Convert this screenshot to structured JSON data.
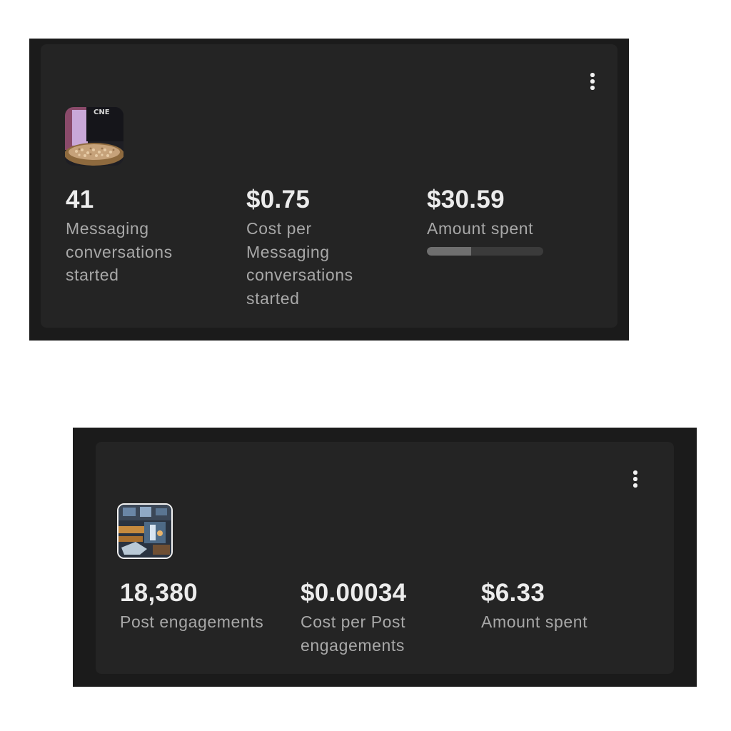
{
  "cards": [
    {
      "thumb_icon": "food-bowl-thumbnail",
      "thumb_text": "CNE",
      "metrics": [
        {
          "value": "41",
          "label_lines": [
            "Messaging",
            "conversations",
            "started"
          ]
        },
        {
          "value": "$0.75",
          "label_lines": [
            "Cost per",
            "Messaging",
            "conversations",
            "started"
          ]
        },
        {
          "value": "$30.59",
          "label_lines": [
            "Amount spent"
          ]
        }
      ],
      "spend_progress": 0.38,
      "menu_icon": "more-vertical-icon"
    },
    {
      "thumb_icon": "restaurant-thumbnail",
      "metrics": [
        {
          "value": "18,380",
          "label_lines": [
            "Post engagements"
          ]
        },
        {
          "value": "$0.00034",
          "label_lines": [
            "Cost per Post",
            "engagements"
          ]
        },
        {
          "value": "$6.33",
          "label_lines": [
            "Amount spent"
          ]
        }
      ],
      "menu_icon": "more-vertical-icon"
    }
  ],
  "colors": {
    "panel": "#1b1b1b",
    "card": "#242424",
    "value_text": "#ececec",
    "label_text": "#a8a8a8",
    "progress_track": "#3b3b3b",
    "progress_fill": "#6f6f6f"
  }
}
